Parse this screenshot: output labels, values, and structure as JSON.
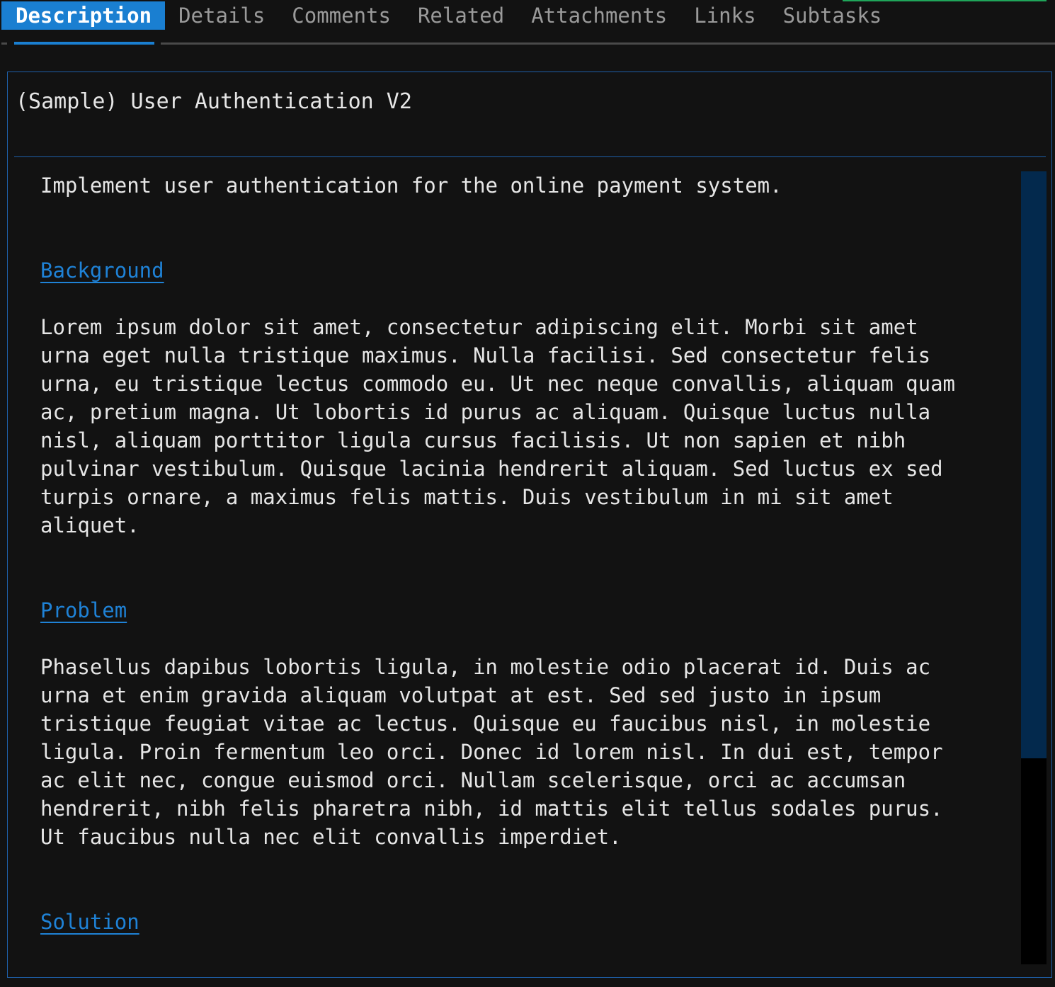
{
  "tabs": [
    {
      "label": "Description",
      "active": true
    },
    {
      "label": "Details",
      "active": false
    },
    {
      "label": "Comments",
      "active": false
    },
    {
      "label": "Related",
      "active": false
    },
    {
      "label": "Attachments",
      "active": false
    },
    {
      "label": "Links",
      "active": false
    },
    {
      "label": "Subtasks",
      "active": false
    }
  ],
  "issue": {
    "title": "(Sample) User Authentication V2",
    "summary": "Implement user authentication for the online payment system."
  },
  "sections": [
    {
      "heading": "Background",
      "text": "Lorem ipsum dolor sit amet, consectetur adipiscing elit. Morbi sit amet\nurna eget nulla tristique maximus. Nulla facilisi. Sed consectetur felis\nurna, eu tristique lectus commodo eu. Ut nec neque convallis, aliquam quam\nac, pretium magna. Ut lobortis id purus ac aliquam. Quisque luctus nulla\nnisl, aliquam porttitor ligula cursus facilisis. Ut non sapien et nibh\npulvinar vestibulum. Quisque lacinia hendrerit aliquam. Sed luctus ex sed\nturpis ornare, a maximus felis mattis. Duis vestibulum in mi sit amet\naliquet."
    },
    {
      "heading": "Problem",
      "text": "Phasellus dapibus lobortis ligula, in molestie odio placerat id. Duis ac\nurna et enim gravida aliquam volutpat at est. Sed sed justo in ipsum\ntristique feugiat vitae ac lectus. Quisque eu faucibus nisl, in molestie\nligula. Proin fermentum leo orci. Donec id lorem nisl. In dui est, tempor\nac elit nec, congue euismod orci. Nullam scelerisque, orci ac accumsan\nhendrerit, nibh felis pharetra nibh, id mattis elit tellus sodales purus.\nUt faucibus nulla nec elit convallis imperdiet."
    },
    {
      "heading": "Solution",
      "text": ""
    }
  ],
  "scroll": {
    "visible_fraction": 0.74,
    "position_fraction": 0.0
  },
  "colors": {
    "background": "#121212",
    "accent": "#1a7fd1",
    "link": "#1f82d6",
    "panel_border": "#1e5fa8",
    "scroll_thumb": "#03294d",
    "indicator_green": "#1fa55a"
  }
}
